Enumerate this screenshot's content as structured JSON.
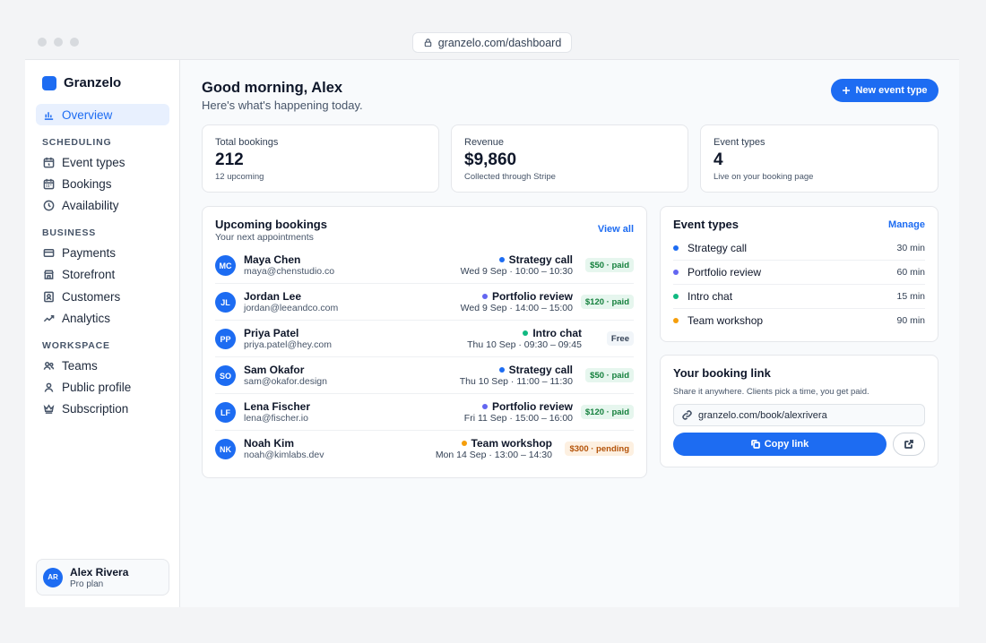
{
  "browser": {
    "url": "granzelo.com/dashboard"
  },
  "brand": {
    "name": "Granzelo",
    "color": "#1d6cf2"
  },
  "sidebar": {
    "overview": {
      "label": "Overview",
      "icon": "bar-chart-icon"
    },
    "sections": [
      {
        "title": "SCHEDULING",
        "items": [
          {
            "label": "Event types",
            "icon": "calendar-clock-icon"
          },
          {
            "label": "Bookings",
            "icon": "calendar-icon"
          },
          {
            "label": "Availability",
            "icon": "clock-icon"
          }
        ]
      },
      {
        "title": "BUSINESS",
        "items": [
          {
            "label": "Payments",
            "icon": "credit-card-icon"
          },
          {
            "label": "Storefront",
            "icon": "store-icon"
          },
          {
            "label": "Customers",
            "icon": "contact-icon"
          },
          {
            "label": "Analytics",
            "icon": "trend-icon"
          }
        ]
      },
      {
        "title": "WORKSPACE",
        "items": [
          {
            "label": "Teams",
            "icon": "users-icon"
          },
          {
            "label": "Public profile",
            "icon": "user-icon"
          },
          {
            "label": "Subscription",
            "icon": "crown-icon"
          }
        ]
      }
    ],
    "user": {
      "initials": "AR",
      "name": "Alex Rivera",
      "plan": "Pro plan"
    }
  },
  "header": {
    "greeting": "Good morning, Alex",
    "subtitle": "Here's what's happening today.",
    "new_event_label": "New event type"
  },
  "stats": [
    {
      "label": "Total bookings",
      "value": "212",
      "note": "12 upcoming"
    },
    {
      "label": "Revenue",
      "value": "$9,860",
      "note": "Collected through Stripe"
    },
    {
      "label": "Event types",
      "value": "4",
      "note": "Live on your booking page"
    }
  ],
  "upcoming": {
    "title": "Upcoming bookings",
    "subtitle": "Your next appointments",
    "view_all": "View all",
    "rows": [
      {
        "initials": "MC",
        "name": "Maya Chen",
        "email": "maya@chenstudio.co",
        "type": "Strategy call",
        "type_color": "#1d6cf2",
        "when": "Wed 9 Sep · 10:00 – 10:30",
        "badge": "$50 · paid",
        "badge_kind": "paid"
      },
      {
        "initials": "JL",
        "name": "Jordan Lee",
        "email": "jordan@leeandco.com",
        "type": "Portfolio review",
        "type_color": "#6366f1",
        "when": "Wed 9 Sep · 14:00 – 15:00",
        "badge": "$120 · paid",
        "badge_kind": "paid"
      },
      {
        "initials": "PP",
        "name": "Priya Patel",
        "email": "priya.patel@hey.com",
        "type": "Intro chat",
        "type_color": "#10b981",
        "when": "Thu 10 Sep · 09:30 – 09:45",
        "badge": "Free",
        "badge_kind": "free"
      },
      {
        "initials": "SO",
        "name": "Sam Okafor",
        "email": "sam@okafor.design",
        "type": "Strategy call",
        "type_color": "#1d6cf2",
        "when": "Thu 10 Sep · 11:00 – 11:30",
        "badge": "$50 · paid",
        "badge_kind": "paid"
      },
      {
        "initials": "LF",
        "name": "Lena Fischer",
        "email": "lena@fischer.io",
        "type": "Portfolio review",
        "type_color": "#6366f1",
        "when": "Fri 11 Sep · 15:00 – 16:00",
        "badge": "$120 · paid",
        "badge_kind": "paid"
      },
      {
        "initials": "NK",
        "name": "Noah Kim",
        "email": "noah@kimlabs.dev",
        "type": "Team workshop",
        "type_color": "#f59e0b",
        "when": "Mon 14 Sep · 13:00 – 14:30",
        "badge": "$300 · pending",
        "badge_kind": "pending"
      }
    ]
  },
  "event_types": {
    "title": "Event types",
    "manage": "Manage",
    "items": [
      {
        "name": "Strategy call",
        "duration": "30 min",
        "color": "#1d6cf2"
      },
      {
        "name": "Portfolio review",
        "duration": "60 min",
        "color": "#6366f1"
      },
      {
        "name": "Intro chat",
        "duration": "15 min",
        "color": "#10b981"
      },
      {
        "name": "Team workshop",
        "duration": "90 min",
        "color": "#f59e0b"
      }
    ]
  },
  "booking_link": {
    "title": "Your booking link",
    "subtitle": "Share it anywhere. Clients pick a time, you get paid.",
    "url": "granzelo.com/book/alexrivera",
    "copy_label": "Copy link"
  }
}
